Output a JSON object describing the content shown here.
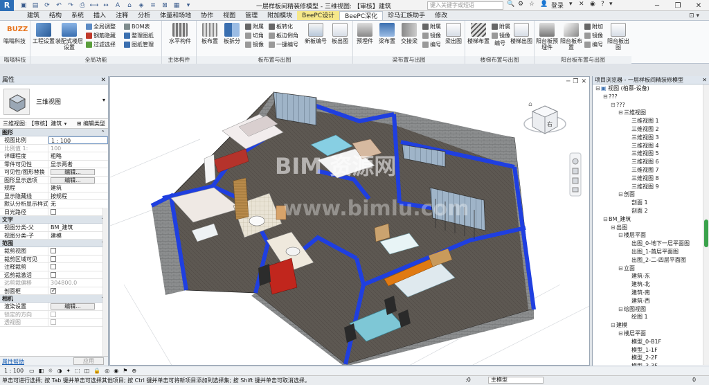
{
  "window": {
    "title": "一层样板间精装修模型 - 三维视图: 【审核】建筑",
    "search_placeholder": "键入关键字或短语",
    "user_label": "登录",
    "help_label": "?"
  },
  "ribbon_tabs": [
    "建筑",
    "结构",
    "系统",
    "插入",
    "注释",
    "分析",
    "体量和场地",
    "协作",
    "视图",
    "管理",
    "附加模块",
    "BeePC设计",
    "BeePC深化",
    "珍马汇族助手",
    "修改"
  ],
  "selected_tab_index": 12,
  "highlight_tab_index": 11,
  "ribbon_panels": {
    "buzz": {
      "label": "嗡嗡科技",
      "buttons": [
        "嗡嗡科技"
      ]
    },
    "global": {
      "label": "全局功能",
      "big": [
        "工程设置",
        "装配式楼层设置"
      ],
      "small": [
        "全局调整",
        "钢筋隐藏",
        "过滤选择",
        "BOM表",
        "整理图纸",
        "图纸管理"
      ]
    },
    "main": {
      "label": "主体构件",
      "big": [
        "水平构件"
      ]
    },
    "slab": {
      "label": "板布置与出图",
      "big": [
        "板布置",
        "板拆分",
        "新板编号",
        "板出图"
      ],
      "small": [
        "附属",
        "切角",
        "镜像",
        "板转化",
        "板边倒角",
        "一键编号"
      ]
    },
    "beam": {
      "label": "梁布置与出图",
      "big": [
        "预埋件",
        "梁布置",
        "交接梁",
        "梁出图"
      ],
      "small": [
        "附属",
        "镜像",
        "编号"
      ]
    },
    "stair": {
      "label": "楼梯布置与出图",
      "big": [
        "楼梯布置",
        "编号"
      ],
      "small": [
        "附属",
        "镜像",
        "楼梯出图"
      ]
    },
    "balcony": {
      "label": "阳台板布置与出图",
      "big": [
        "阳台板预埋件",
        "阳台板布置",
        "阳台板出图"
      ],
      "small": [
        "附加",
        "镜像",
        "编号"
      ]
    }
  },
  "properties": {
    "panel_title": "属性",
    "type_name": "三维视图",
    "instance_label": "三维视图: 【审核】建筑",
    "edit_type_label": "编辑类型",
    "groups": [
      {
        "name": "图形",
        "rows": [
          {
            "k": "视图比例",
            "v": "1 : 100",
            "kind": "input"
          },
          {
            "k": "比例值 1:",
            "v": "100",
            "kind": "dim"
          },
          {
            "k": "详细程度",
            "v": "粗略",
            "kind": "text"
          },
          {
            "k": "零件可见性",
            "v": "显示两者",
            "kind": "text"
          },
          {
            "k": "可见性/图形替换",
            "v": "编辑...",
            "kind": "button"
          },
          {
            "k": "图形显示选项",
            "v": "编辑...",
            "kind": "button"
          },
          {
            "k": "规程",
            "v": "建筑",
            "kind": "text"
          },
          {
            "k": "显示隐藏线",
            "v": "按规程",
            "kind": "text"
          },
          {
            "k": "默认分析显示样式",
            "v": "无",
            "kind": "text"
          },
          {
            "k": "日光路径",
            "v": "",
            "kind": "check"
          }
        ]
      },
      {
        "name": "文字",
        "rows": [
          {
            "k": "视图分类-父",
            "v": "BM_建筑",
            "kind": "text"
          },
          {
            "k": "视图分类-子",
            "v": "建模",
            "kind": "text"
          }
        ]
      },
      {
        "name": "范围",
        "rows": [
          {
            "k": "裁剪视图",
            "v": "",
            "kind": "check"
          },
          {
            "k": "裁剪区域可见",
            "v": "",
            "kind": "check"
          },
          {
            "k": "注释裁剪",
            "v": "",
            "kind": "check"
          },
          {
            "k": "远剪裁激活",
            "v": "",
            "kind": "check"
          },
          {
            "k": "远剪裁偏移",
            "v": "304800.0",
            "kind": "dim"
          },
          {
            "k": "剖面框",
            "v": "",
            "kind": "checked"
          }
        ]
      },
      {
        "name": "相机",
        "rows": [
          {
            "k": "渲染设置",
            "v": "编辑...",
            "kind": "button"
          },
          {
            "k": "锁定的方向",
            "v": "",
            "kind": "dimcheck"
          },
          {
            "k": "透视图",
            "v": "",
            "kind": "dimcheck"
          }
        ]
      }
    ],
    "help_link": "属性帮助",
    "apply_label": "应用"
  },
  "viewport": {
    "watermark": "BIM 资源网",
    "watermark_url": "www.bimlu.com",
    "viewcube_label": "右"
  },
  "browser": {
    "title": "项目浏览器 - 一层样板间精装修模型",
    "nodes": [
      {
        "t": "视图 (柏慕-设备)",
        "d": 0,
        "tog": "⊟",
        "icon": true
      },
      {
        "t": "???",
        "d": 1,
        "tog": "⊟"
      },
      {
        "t": "???",
        "d": 2,
        "tog": "⊟"
      },
      {
        "t": "三维视图",
        "d": 3,
        "tog": "⊟"
      },
      {
        "t": "三维视图 1",
        "d": 4
      },
      {
        "t": "三维视图 2",
        "d": 4
      },
      {
        "t": "三维视图 3",
        "d": 4
      },
      {
        "t": "三维视图 4",
        "d": 4
      },
      {
        "t": "三维视图 5",
        "d": 4
      },
      {
        "t": "三维视图 6",
        "d": 4
      },
      {
        "t": "三维视图 7",
        "d": 4
      },
      {
        "t": "三维视图 8",
        "d": 4
      },
      {
        "t": "三维视图 9",
        "d": 4
      },
      {
        "t": "剖面",
        "d": 3,
        "tog": "⊟"
      },
      {
        "t": "剖面 1",
        "d": 4
      },
      {
        "t": "剖面 2",
        "d": 4
      },
      {
        "t": "BM_建筑",
        "d": 1,
        "tog": "⊟"
      },
      {
        "t": "出图",
        "d": 2,
        "tog": "⊟"
      },
      {
        "t": "楼层平面",
        "d": 3,
        "tog": "⊟"
      },
      {
        "t": "出图_0-地下一层平面图",
        "d": 4
      },
      {
        "t": "出图_1-首层平面图",
        "d": 4
      },
      {
        "t": "出图_2-二-四层平面图",
        "d": 4
      },
      {
        "t": "立面",
        "d": 3,
        "tog": "⊟"
      },
      {
        "t": "建筑-东",
        "d": 4
      },
      {
        "t": "建筑-北",
        "d": 4
      },
      {
        "t": "建筑-南",
        "d": 4
      },
      {
        "t": "建筑-西",
        "d": 4
      },
      {
        "t": "绘图视图",
        "d": 3,
        "tog": "⊟"
      },
      {
        "t": "绘图 1",
        "d": 4
      },
      {
        "t": "建模",
        "d": 2,
        "tog": "⊟"
      },
      {
        "t": "楼层平面",
        "d": 3,
        "tog": "⊟"
      },
      {
        "t": "模型_0-B1F",
        "d": 4
      },
      {
        "t": "模型_1-1F",
        "d": 4
      },
      {
        "t": "模型_2-2F",
        "d": 4
      },
      {
        "t": "模型_3-3F",
        "d": 4
      }
    ]
  },
  "viewbar": {
    "scale": "1 : 100"
  },
  "status": {
    "message": "单击可进行选择; 按 Tab 键并单击可选择其他项目; 按 Ctrl 键并单击可将新项目添加到选择集; 按 Shift 键并单击可取消选择。",
    "zero": ":0",
    "model": "主模型",
    "filter_count": "0"
  },
  "colors": {
    "accent": "#2e6fb7",
    "wall_cap": "#1f3fe0",
    "tab_highlight": "#f6e88a"
  }
}
